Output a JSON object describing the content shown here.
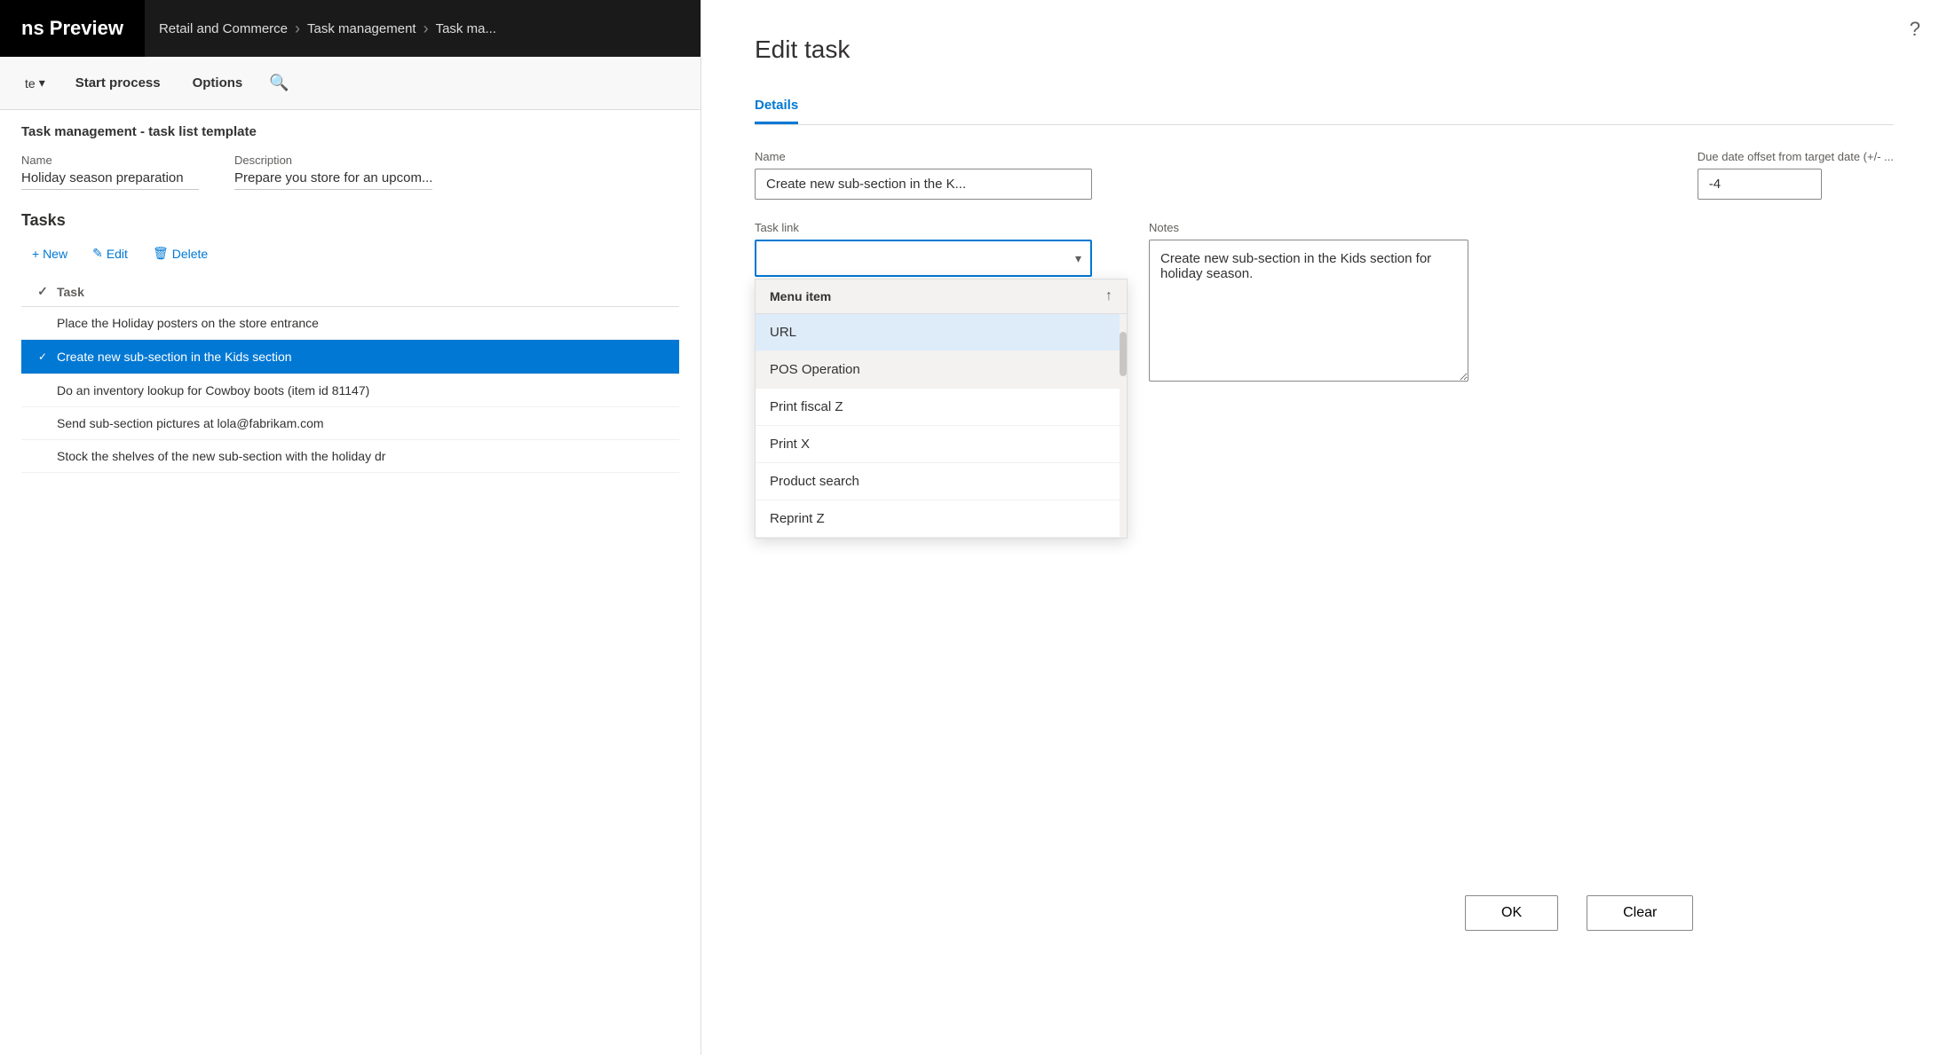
{
  "nav": {
    "app_title": "ns Preview",
    "breadcrumbs": [
      "Retail and Commerce",
      "Task management",
      "Task ma..."
    ]
  },
  "toolbar": {
    "dropdown_label": "te",
    "start_process": "Start process",
    "options": "Options"
  },
  "page": {
    "title": "Task management - task list template",
    "name_label": "Name",
    "name_value": "Holiday season preparation",
    "description_label": "Description",
    "description_value": "Prepare you store for an upcom..."
  },
  "tasks": {
    "header": "Tasks",
    "new_btn": "+ New",
    "edit_btn": "Edit",
    "delete_btn": "Delete",
    "task_col_header": "Task",
    "items": [
      {
        "id": 1,
        "text": "Place the Holiday posters on the store entrance",
        "checked": false,
        "selected": false
      },
      {
        "id": 2,
        "text": "Create new sub-section in the Kids section",
        "checked": true,
        "selected": true
      },
      {
        "id": 3,
        "text": "Do an inventory lookup for Cowboy boots (item id 81147)",
        "checked": false,
        "selected": false
      },
      {
        "id": 4,
        "text": "Send sub-section pictures at lola@fabrikam.com",
        "checked": false,
        "selected": false
      },
      {
        "id": 5,
        "text": "Stock the shelves of the new sub-section with the holiday dr",
        "checked": false,
        "selected": false
      }
    ]
  },
  "edit_task": {
    "title": "Edit task",
    "tab_details": "Details",
    "name_label": "Name",
    "name_value": "Create new sub-section in the K...",
    "due_date_label": "Due date offset from target date (+/- ...",
    "due_date_value": "-4",
    "task_link_label": "Task link",
    "task_link_value": "",
    "task_link_placeholder": "",
    "notes_label": "Notes",
    "notes_value": "Create new sub-section in the Kids section for holiday season.",
    "selected_operation": "POS Operation",
    "dropdown": {
      "header": "Menu item",
      "items": [
        {
          "label": "URL",
          "highlighted": true
        },
        {
          "label": "POS Operation",
          "selected": true
        },
        {
          "label": "Print fiscal Z",
          "highlighted": false
        },
        {
          "label": "Print X",
          "highlighted": false
        },
        {
          "label": "Product search",
          "highlighted": false
        },
        {
          "label": "Reprint Z",
          "highlighted": false
        }
      ]
    },
    "ok_btn": "OK",
    "clear_btn": "Clear"
  },
  "icons": {
    "chevron_down": "▾",
    "chevron_right": "›",
    "check": "✓",
    "plus": "+",
    "edit_pencil": "✎",
    "delete_trash": "🗑",
    "search": "🔍",
    "sort_up": "↑",
    "help": "?"
  }
}
